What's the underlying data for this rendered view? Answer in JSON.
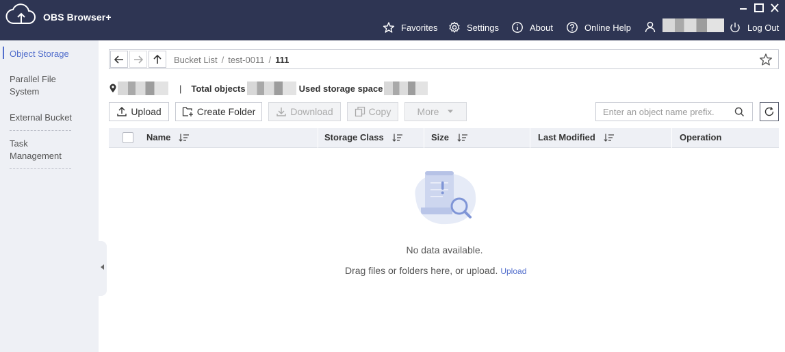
{
  "app": {
    "title": "OBS Browser+"
  },
  "header": {
    "favorites_label": "Favorites",
    "settings_label": "Settings",
    "about_label": "About",
    "help_label": "Online Help",
    "logout_label": "Log Out"
  },
  "sidebar": {
    "items": [
      {
        "label": "Object Storage",
        "active": true
      },
      {
        "label": "Parallel File System",
        "active": false
      },
      {
        "label": "External Bucket",
        "active": false
      },
      {
        "label": "Task Management",
        "active": false
      }
    ]
  },
  "address": {
    "crumbs": [
      "Bucket List",
      "test-0011",
      "111"
    ]
  },
  "info": {
    "total_objects_label": "Total objects",
    "used_storage_label": "Used storage space",
    "separator": "|"
  },
  "toolbar": {
    "upload_label": "Upload",
    "create_folder_label": "Create Folder",
    "download_label": "Download",
    "copy_label": "Copy",
    "more_label": "More",
    "search_placeholder": "Enter an object name prefix."
  },
  "table": {
    "columns": [
      "Name",
      "Storage Class",
      "Size",
      "Last Modified",
      "Operation"
    ]
  },
  "empty": {
    "title": "No data available.",
    "subtitle": "Drag files or folders here, or upload.",
    "upload_link": "Upload"
  },
  "colors": {
    "titlebar": "#2e3553",
    "sidebar": "#eef0f5",
    "accent": "#526ecc"
  }
}
